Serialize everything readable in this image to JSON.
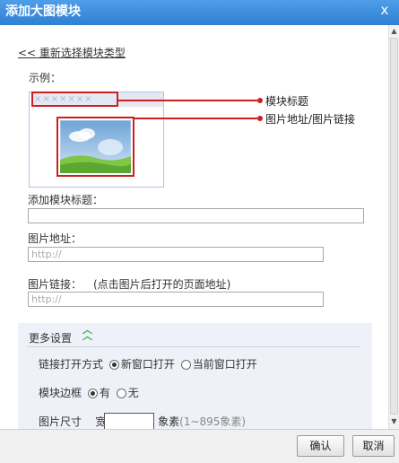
{
  "dialog": {
    "title": "添加大图模块",
    "close_glyph": "x"
  },
  "back_link": "<< 重新选择模块类型",
  "example": {
    "label": "示例：",
    "placeholder_title": "×××××××",
    "callout_title": "模块标题",
    "callout_image": "图片地址/图片链接"
  },
  "fields": {
    "title_label": "添加模块标题：",
    "title_value": "",
    "image_url_label": "图片地址：",
    "image_url_placeholder": "http://",
    "image_link_label": "图片链接：",
    "image_link_hint": "(点击图片后打开的页面地址)",
    "image_link_placeholder": "http://"
  },
  "more": {
    "title": "更多设置",
    "link_open_label": "链接打开方式",
    "link_open_new": "新窗口打开",
    "link_open_current": "当前窗口打开",
    "link_open_selected": "new",
    "border_label": "模块边框",
    "border_yes": "有",
    "border_no": "无",
    "border_selected": "yes",
    "size_label": "图片尺寸",
    "width_label": "宽",
    "pixel_unit": "象素",
    "pixel_hint": "(1~895象素)"
  },
  "buttons": {
    "confirm": "确认",
    "cancel": "取消"
  },
  "colors": {
    "titlebar": "#2f7fd3",
    "callout_red": "#cc1f1f",
    "panel_bg": "#eef2f8",
    "expand_arrow": "#3bb34a"
  }
}
